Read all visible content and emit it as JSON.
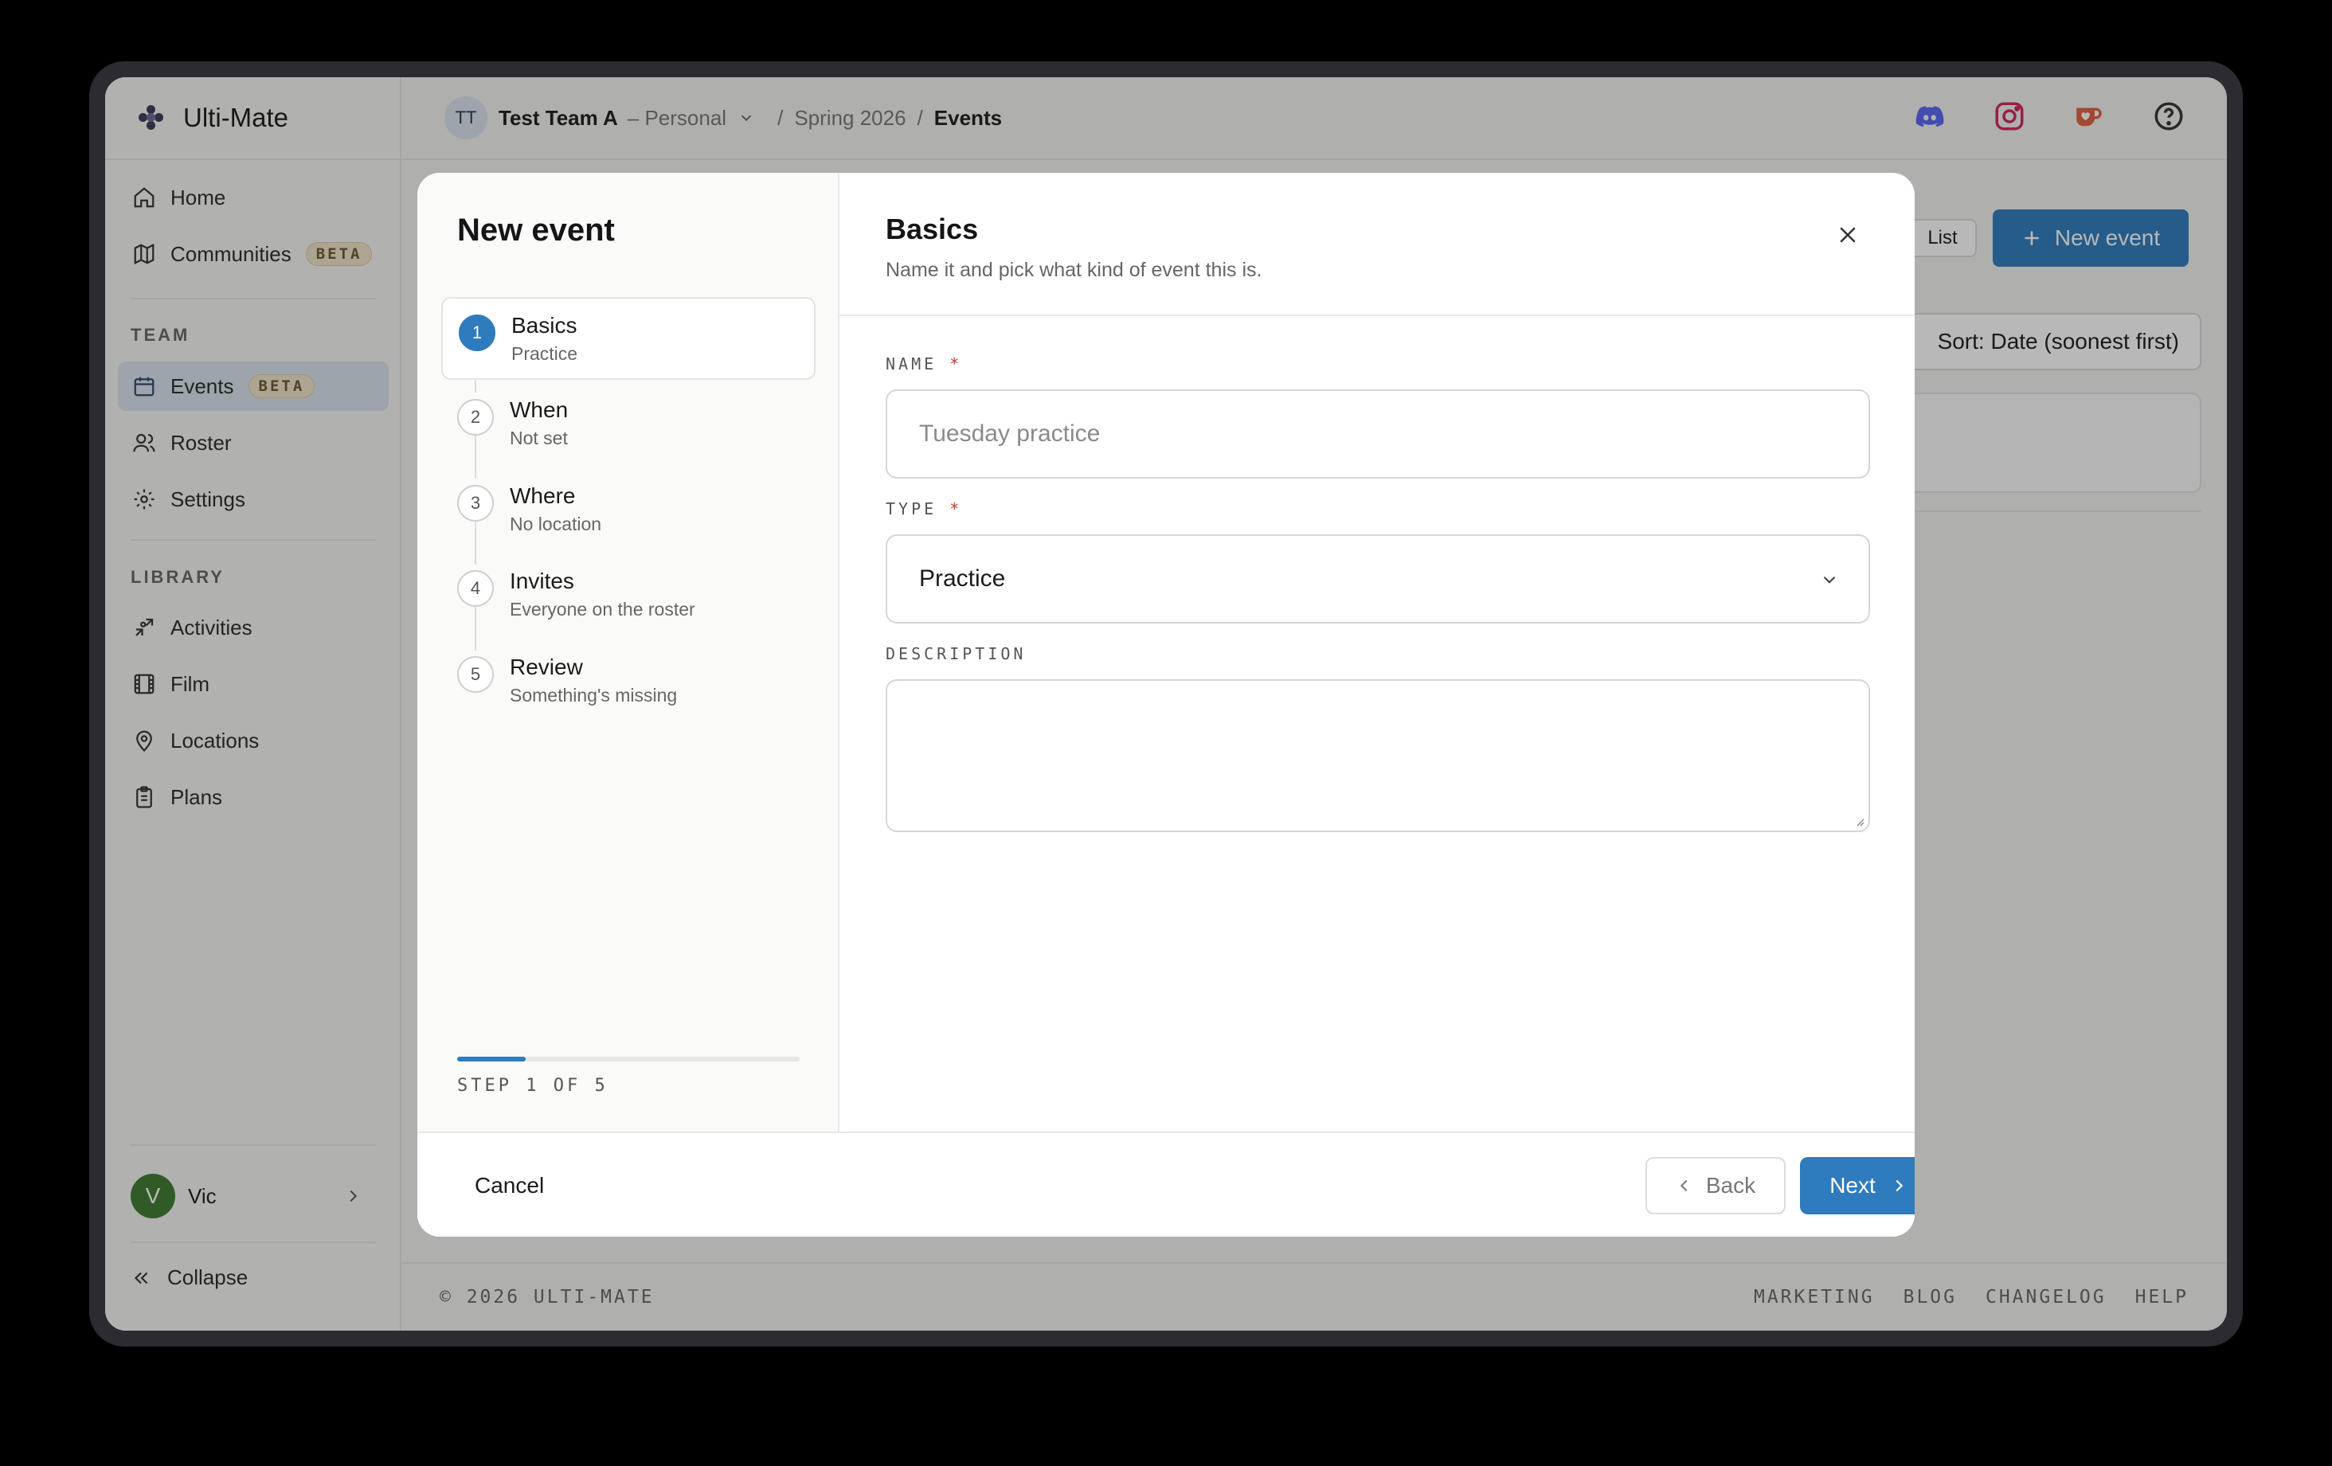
{
  "app": {
    "name": "Ulti-Mate"
  },
  "sidebar": {
    "primary": [
      {
        "label": "Home",
        "icon": "home-icon"
      },
      {
        "label": "Communities",
        "icon": "map-icon",
        "badge": "BETA"
      }
    ],
    "team_label": "TEAM",
    "team": [
      {
        "label": "Events",
        "icon": "calendar-icon",
        "badge": "BETA",
        "active": true
      },
      {
        "label": "Roster",
        "icon": "users-icon"
      },
      {
        "label": "Settings",
        "icon": "gear-icon"
      }
    ],
    "library_label": "LIBRARY",
    "library": [
      {
        "label": "Activities",
        "icon": "puzzle-icon"
      },
      {
        "label": "Film",
        "icon": "film-icon"
      },
      {
        "label": "Locations",
        "icon": "location-pin-icon"
      },
      {
        "label": "Plans",
        "icon": "clipboard-icon"
      }
    ],
    "user": {
      "initial": "V",
      "name": "Vic"
    },
    "collapse_label": "Collapse"
  },
  "topbar": {
    "team_initials": "TT",
    "team_name": "Test Team A",
    "team_kind": "– Personal",
    "season": "Spring 2026",
    "page": "Events",
    "separator": "/",
    "icons": [
      "discord-icon",
      "instagram-icon",
      "ko-fi-icon",
      "help-icon"
    ]
  },
  "page": {
    "list_label": "List",
    "new_event_label": "New event",
    "sort_label": "Sort: Date (soonest first)"
  },
  "footer": {
    "copyright": "© 2026 ULTI-MATE",
    "links": [
      "MARKETING",
      "BLOG",
      "CHANGELOG",
      "HELP"
    ]
  },
  "modal": {
    "title": "New event",
    "steps": [
      {
        "num": "1",
        "title": "Basics",
        "sub": "Practice",
        "current": true
      },
      {
        "num": "2",
        "title": "When",
        "sub": "Not set"
      },
      {
        "num": "3",
        "title": "Where",
        "sub": "No location"
      },
      {
        "num": "4",
        "title": "Invites",
        "sub": "Everyone on the roster"
      },
      {
        "num": "5",
        "title": "Review",
        "sub": "Something's missing"
      }
    ],
    "progress": 0.2,
    "step_count": "STEP 1 OF 5",
    "panel": {
      "title": "Basics",
      "subtitle": "Name it and pick what kind of event this is.",
      "name_label": "NAME",
      "name_placeholder": "Tuesday practice",
      "name_value": "",
      "type_label": "TYPE",
      "type_value": "Practice",
      "description_label": "DESCRIPTION",
      "description_value": "",
      "required_mark": "*"
    },
    "buttons": {
      "cancel": "Cancel",
      "back": "Back",
      "next": "Next"
    }
  },
  "colors": {
    "accent": "#2e7bbd",
    "required": "#c0392b",
    "active_nav": "#d8e2ec",
    "user_avatar": "#3e7a2e"
  }
}
